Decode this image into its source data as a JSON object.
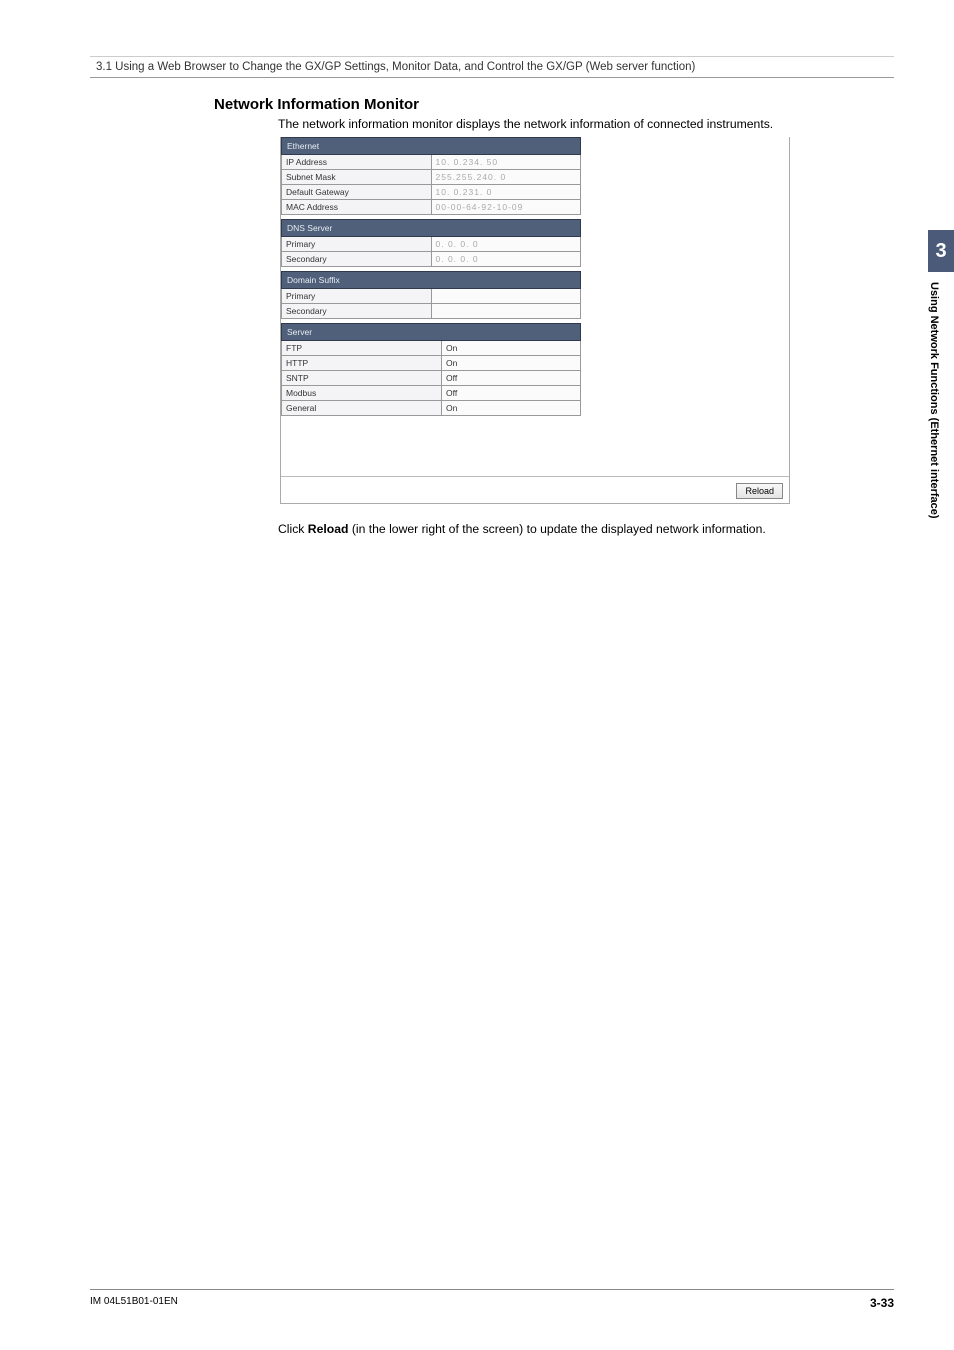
{
  "breadcrumb": "3.1  Using a Web Browser to Change the GX/GP Settings, Monitor Data, and Control the GX/GP (Web server function)",
  "title": "Network Information Monitor",
  "intro": "The network information monitor displays the network information of connected instruments.",
  "note_prefix": "Click ",
  "note_bold": "Reload",
  "note_suffix": " (in the lower right of the screen) to update the displayed network information.",
  "ethernet": {
    "header": "Ethernet",
    "rows": [
      {
        "label": "IP Address",
        "value": "10.  0.234. 50"
      },
      {
        "label": "Subnet Mask",
        "value": "255.255.240.  0"
      },
      {
        "label": "Default Gateway",
        "value": "10.  0.231.  0"
      },
      {
        "label": "MAC Address",
        "value": "00-00-64-92-10-09"
      }
    ]
  },
  "dns": {
    "header": "DNS Server",
    "rows": [
      {
        "label": "Primary",
        "value": "0.  0.  0.  0"
      },
      {
        "label": "Secondary",
        "value": "0.  0.  0.  0"
      }
    ]
  },
  "domain": {
    "header": "Domain Suffix",
    "rows": [
      {
        "label": "Primary",
        "value": ""
      },
      {
        "label": "Secondary",
        "value": ""
      }
    ]
  },
  "server": {
    "header": "Server",
    "rows": [
      {
        "label": "FTP",
        "value": "On"
      },
      {
        "label": "HTTP",
        "value": "On"
      },
      {
        "label": "SNTP",
        "value": "Off"
      },
      {
        "label": "Modbus",
        "value": "Off"
      },
      {
        "label": "General",
        "value": "On"
      }
    ]
  },
  "reload_label": "Reload",
  "sidebar": {
    "chapter": "3",
    "text": "Using Network Functions (Ethernet interface)"
  },
  "footer": {
    "doc": "IM 04L51B01-01EN",
    "page": "3-33"
  }
}
